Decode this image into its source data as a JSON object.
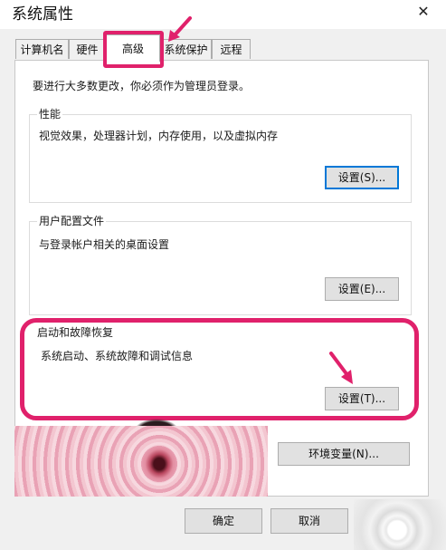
{
  "window": {
    "title": "系统属性",
    "close_glyph": "✕"
  },
  "tabs": [
    {
      "label": "计算机名",
      "selected": false
    },
    {
      "label": "硬件",
      "selected": false
    },
    {
      "label": "高级",
      "selected": true
    },
    {
      "label": "系统保护",
      "selected": false
    },
    {
      "label": "远程",
      "selected": false
    }
  ],
  "admin_note": "要进行大多数更改，你必须作为管理员登录。",
  "performance": {
    "title": "性能",
    "description": "视觉效果，处理器计划，内存使用，以及虚拟内存",
    "button": "设置(S)..."
  },
  "user_profiles": {
    "title": "用户配置文件",
    "description": "与登录帐户相关的桌面设置",
    "button": "设置(E)..."
  },
  "startup_recovery": {
    "title": "启动和故障恢复",
    "description": "系统启动、系统故障和调试信息",
    "button": "设置(T)..."
  },
  "env_button": "环境变量(N)...",
  "footer": {
    "ok": "确定",
    "cancel": "取消"
  },
  "highlight_color": "#e0216b",
  "focus_color": "#0078d7",
  "icons": [
    "close-icon",
    "pointer-arrow-icon"
  ]
}
